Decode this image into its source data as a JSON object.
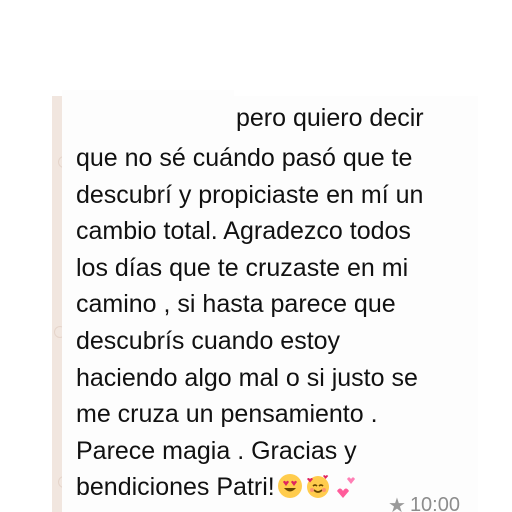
{
  "message": {
    "partial_top": "pero quiero decir",
    "lines": [
      "que no sé cuándo pasó que te",
      "descubrí y propiciaste en mí un",
      "cambio total. Agradezco todos",
      "los días que te cruzaste en mi",
      "camino , si hasta parece que",
      "descubrís cuando estoy",
      "haciendo algo mal o si justo se",
      "me cruza un pensamiento .",
      "Parece magia . Gracias y"
    ],
    "last_line_text": "bendiciones Patri!",
    "emojis": [
      "heart-eyes-emoji",
      "smiling-face-with-hearts-emoji",
      "two-hearts-emoji"
    ],
    "time": "10:00",
    "starred_icon": "star-icon"
  },
  "colors": {
    "chat_background": "#f1e6df",
    "bubble": "#fdfdfd",
    "text": "#111111",
    "meta": "#8d8d8d"
  }
}
